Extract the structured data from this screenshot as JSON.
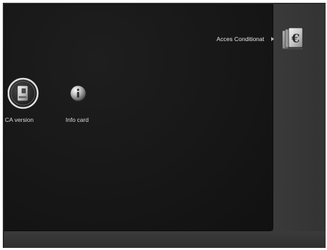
{
  "header": {
    "section_title": "Acces Conditionat",
    "section_icon": "euro-card-icon"
  },
  "menu": {
    "items": [
      {
        "label": "CA version",
        "icon": "ca-version-icon",
        "selected": true
      },
      {
        "label": "Info card",
        "icon": "info-icon",
        "selected": false
      }
    ]
  },
  "colors": {
    "panel_background": "#151515",
    "side_background": "#3a3a3a",
    "text": "#e6e6e6",
    "selection_ring": "#d8d8d8"
  }
}
